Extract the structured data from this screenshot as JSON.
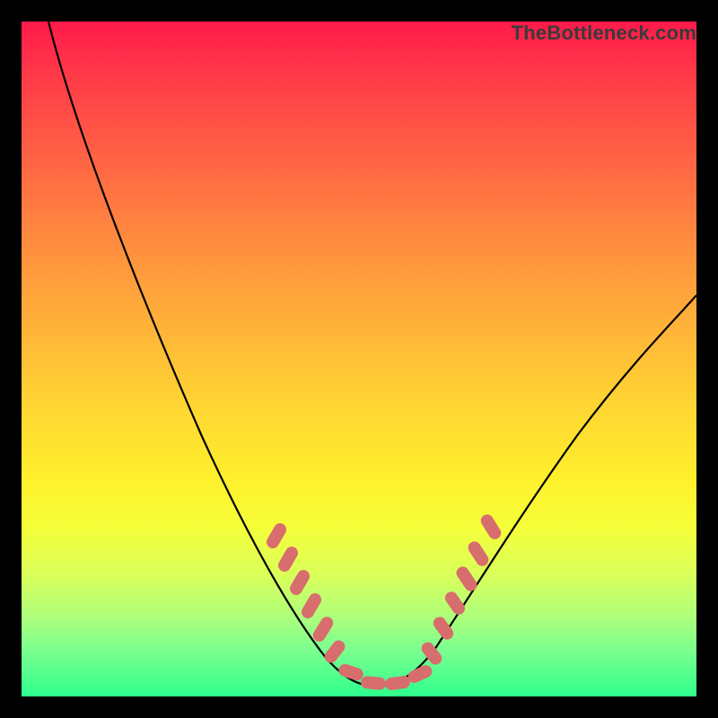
{
  "watermark": "TheBottleneck.com",
  "colors": {
    "gradient_top": "#ff1a4b",
    "gradient_mid": "#fff02c",
    "gradient_bottom": "#2eff8c",
    "curve": "#000000",
    "marker": "#d86d6d",
    "frame": "#000000"
  },
  "chart_data": {
    "type": "line",
    "title": "",
    "xlabel": "",
    "ylabel": "",
    "xlim": [
      0,
      100
    ],
    "ylim": [
      0,
      100
    ],
    "grid": false,
    "series": [
      {
        "name": "bottleneck-curve",
        "x": [
          0,
          5,
          10,
          15,
          20,
          25,
          30,
          35,
          40,
          45,
          48,
          50,
          52,
          55,
          60,
          65,
          70,
          75,
          80,
          85,
          90,
          95,
          100
        ],
        "y": [
          100,
          92,
          83,
          74,
          65,
          56,
          46,
          36,
          25,
          12,
          5,
          2,
          1.5,
          2.5,
          7,
          14,
          22,
          30,
          38,
          45,
          51,
          56,
          60
        ]
      }
    ],
    "annotations": {
      "highlight_segments": [
        {
          "side": "left",
          "x_range": [
            37,
            48
          ],
          "note": "pink rod markers descending"
        },
        {
          "side": "valley",
          "x_range": [
            48,
            58
          ],
          "note": "pink rod markers at minimum"
        },
        {
          "side": "right",
          "x_range": [
            58,
            64
          ],
          "note": "pink rod markers ascending"
        }
      ]
    }
  }
}
